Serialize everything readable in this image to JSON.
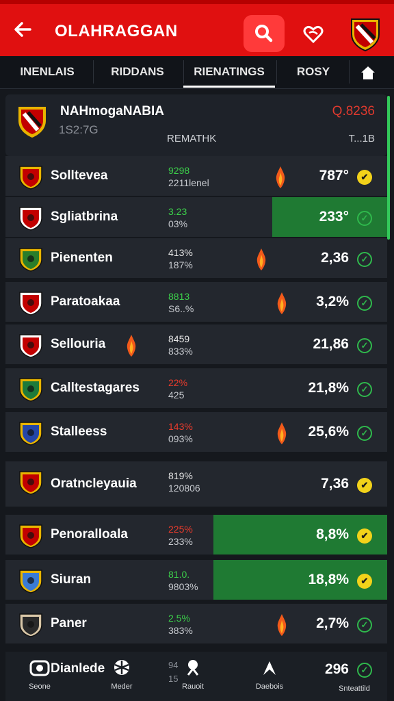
{
  "header": {
    "title": "OLAHRAGGAN"
  },
  "tabs": [
    {
      "label": "INENLAIS"
    },
    {
      "label": "RIDDANS"
    },
    {
      "label": "RIENATINGS"
    },
    {
      "label": "ROSY"
    }
  ],
  "card": {
    "name": "NAHmogaNABIA",
    "sub": "1S2:7G",
    "score": "Q.8236",
    "col1": "REMATHK",
    "col2": "T...1B"
  },
  "rows": [
    {
      "name": "Solltevea",
      "s1": "9298",
      "s2": "2211lenel",
      "value": "787°",
      "check": "yellow",
      "s1color": "green",
      "flame": true
    },
    {
      "name": "Sgliatbrina",
      "s1": "3.23",
      "s2": "03%",
      "value": "233°",
      "check": "green",
      "s1color": "green",
      "flame": false
    },
    {
      "name": "Pienenten",
      "s1": "413%",
      "s2": "187%",
      "value": "2,36",
      "check": "green",
      "s1color": "white",
      "flame": true
    },
    {
      "name": "Paratoakaa",
      "s1": "8813",
      "s2": "S6..%",
      "value": "3,2%",
      "check": "green",
      "s1color": "green",
      "flame": true
    },
    {
      "name": "Sellouria",
      "s1": "8459",
      "s2": "833%",
      "value": "21,86",
      "check": "green",
      "s1color": "white",
      "flame": true
    },
    {
      "name": "Calltestagares",
      "s1": "22%",
      "s2": "425",
      "value": "21,8%",
      "check": "green",
      "s1color": "red",
      "flame": false
    },
    {
      "name": "Stalleess",
      "s1": "143%",
      "s2": "093%",
      "value": "25,6%",
      "check": "green",
      "s1color": "red",
      "flame": true
    },
    {
      "name": "Oratncleyauia",
      "s1": "819%",
      "s2": "120806",
      "value": "7,36",
      "check": "yellow",
      "s1color": "white",
      "flame": false
    },
    {
      "name": "Penoralloala",
      "s1": "225%",
      "s2": "233%",
      "value": "8,8%",
      "check": "yellow",
      "s1color": "red",
      "flame": false
    },
    {
      "name": "Siuran",
      "s1": "81.0.",
      "s2": "9803%",
      "value": "18,8%",
      "check": "yellow",
      "s1color": "green",
      "flame": false
    },
    {
      "name": "Paner",
      "s1": "2.5%",
      "s2": "383%",
      "value": "2,7%",
      "check": "green",
      "s1color": "green",
      "flame": true
    }
  ],
  "bottom": {
    "row_name": "Dianlede",
    "row_val": "296",
    "row_s1": "94",
    "row_s2": "15",
    "nav": [
      {
        "label": "Seone"
      },
      {
        "label": "Meder"
      },
      {
        "label": "Rauoit"
      },
      {
        "label": "Daebois"
      },
      {
        "label": "Snteattild"
      }
    ]
  }
}
